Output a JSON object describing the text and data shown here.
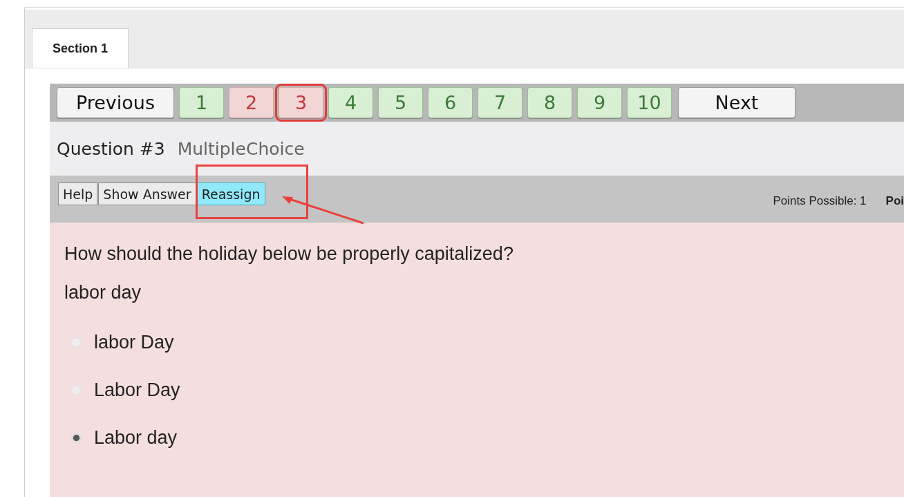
{
  "tabs": [
    {
      "label": "Section 1",
      "selected": true
    }
  ],
  "navigation": {
    "previous": "Previous",
    "next": "Next",
    "questions": [
      {
        "label": "1",
        "correct": true,
        "selected": false
      },
      {
        "label": "2",
        "correct": false,
        "selected": false
      },
      {
        "label": "3",
        "correct": false,
        "selected": true
      },
      {
        "label": "4",
        "correct": true,
        "selected": false
      },
      {
        "label": "5",
        "correct": true,
        "selected": false
      },
      {
        "label": "6",
        "correct": true,
        "selected": false
      },
      {
        "label": "7",
        "correct": true,
        "selected": false
      },
      {
        "label": "8",
        "correct": true,
        "selected": false
      },
      {
        "label": "9",
        "correct": true,
        "selected": false
      },
      {
        "label": "10",
        "correct": true,
        "selected": false
      }
    ]
  },
  "question_header": {
    "number": "Question #3",
    "type": "MultipleChoice"
  },
  "toolbar": {
    "buttons": [
      {
        "label": "Help",
        "highlighted": false
      },
      {
        "label": "Show Answer",
        "highlighted": false
      },
      {
        "label": "Reassign",
        "highlighted": true
      }
    ],
    "points_possible": "Points Possible: 1",
    "column_2": "Poi"
  },
  "question": {
    "prompt": "How should the holiday below be properly capitalized?",
    "term": "labor day",
    "options": [
      {
        "label": "labor Day",
        "selected": false
      },
      {
        "label": "Labor Day",
        "selected": false
      },
      {
        "label": "Labor day",
        "selected": true
      }
    ]
  },
  "annotations": [
    {
      "kind": "box"
    },
    {
      "kind": "arrow"
    }
  ]
}
